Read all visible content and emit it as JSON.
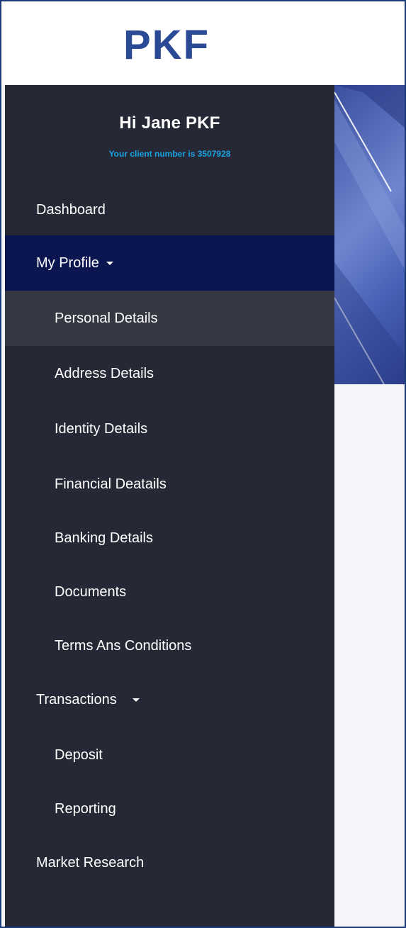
{
  "brand": {
    "logo_text": "PKF",
    "logo_color": "#2a4a96"
  },
  "user": {
    "greeting": "Hi Jane PKF",
    "client_number_text": "Your client number is 3507928"
  },
  "nav": {
    "dashboard": "Dashboard",
    "my_profile": "My Profile",
    "profile_items": [
      "Personal Details",
      "Address Details",
      "Identity Details",
      "Financial Deatails",
      "Banking Details",
      "Documents",
      "Terms Ans Conditions"
    ],
    "transactions": "Transactions",
    "transaction_items": [
      "Deposit",
      "Reporting"
    ],
    "market_research": "Market Research"
  },
  "colors": {
    "sidebar_bg": "#262835",
    "active_bg": "#0b1550",
    "selected_bg": "#353743",
    "client_number": "#1aa3e0"
  },
  "icons": {
    "dropdown": "caret-down-icon"
  }
}
